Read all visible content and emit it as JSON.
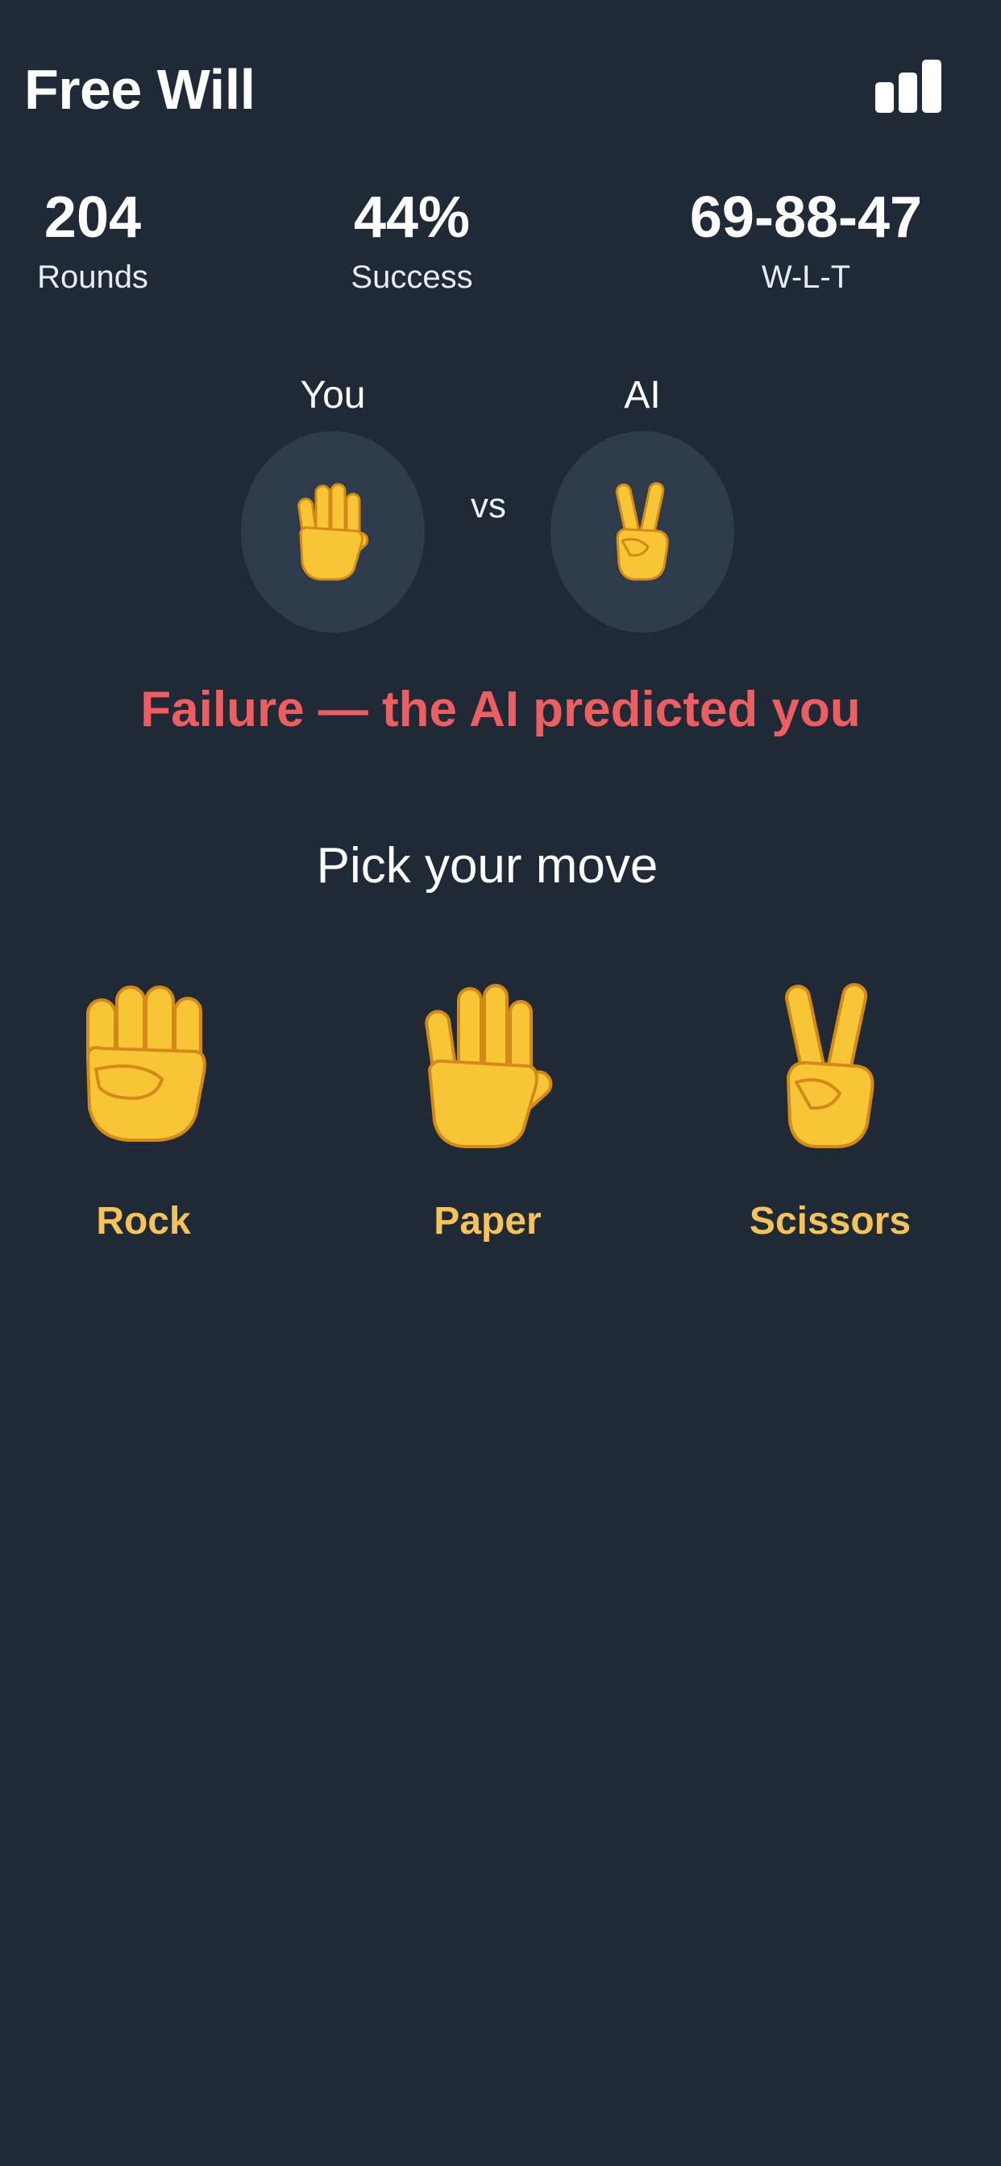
{
  "header": {
    "title": "Free Will",
    "stats_icon": "bar-chart-icon"
  },
  "stats": {
    "rounds": {
      "value": "204",
      "label": "Rounds"
    },
    "success": {
      "value": "44%",
      "label": "Success"
    },
    "wlt": {
      "value": "69-88-47",
      "label": "W-L-T"
    }
  },
  "matchup": {
    "you_label": "You",
    "ai_label": "AI",
    "vs_label": "vs",
    "you_move_icon": "raised-hand-icon",
    "ai_move_icon": "victory-hand-icon"
  },
  "result": {
    "text": "Failure — the AI predicted you",
    "color": "#ec5e62"
  },
  "picker": {
    "title": "Pick your move",
    "options": [
      {
        "label": "Rock",
        "icon": "fist-icon"
      },
      {
        "label": "Paper",
        "icon": "raised-hand-icon"
      },
      {
        "label": "Scissors",
        "icon": "victory-hand-icon"
      }
    ]
  },
  "colors": {
    "background": "#1f2a36",
    "circle": "#2d3b4a",
    "accent": "#f5c35a"
  }
}
